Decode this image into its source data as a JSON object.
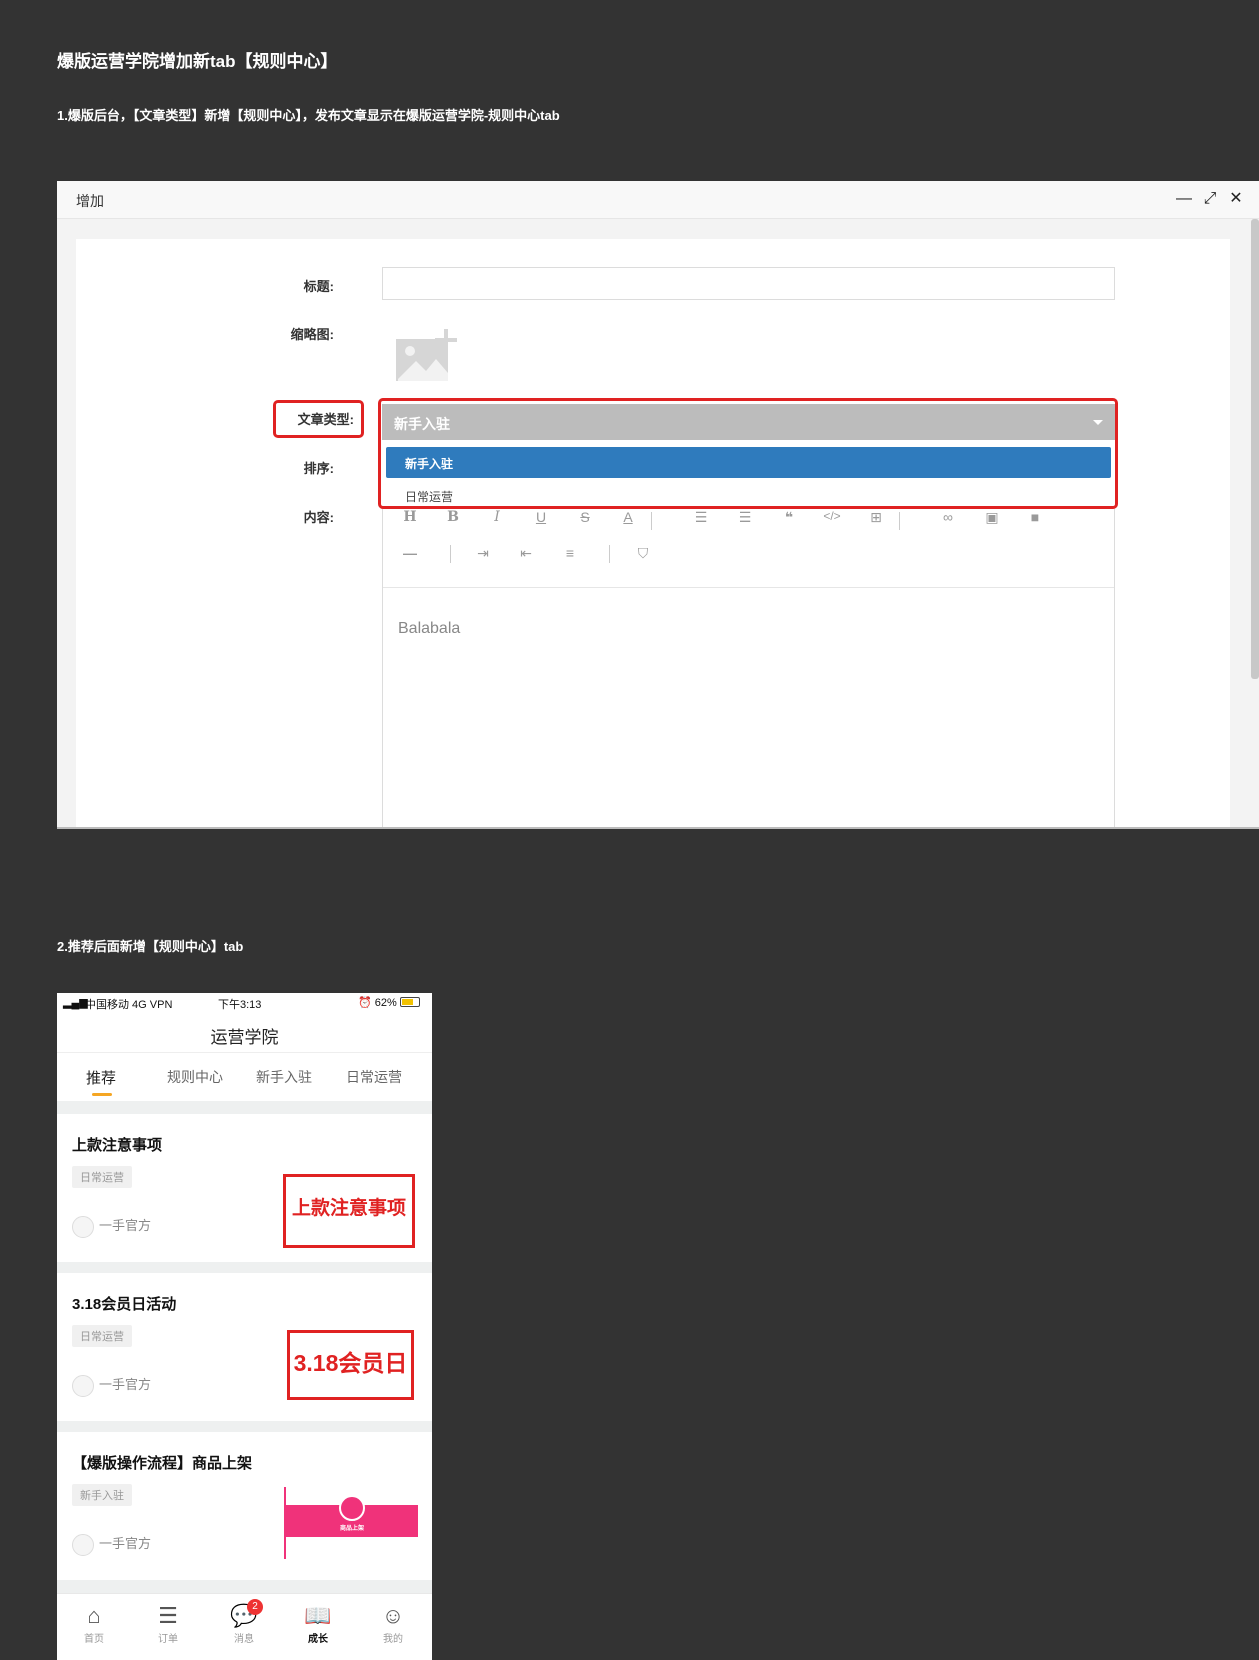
{
  "doc": {
    "title": "爆版运营学院增加新tab【规则中心】",
    "note1": "1.爆版后台，【文章类型】新增【规则中心】，发布文章显示在爆版运营学院-规则中心tab",
    "note2": "2.推荐后面新增【规则中心】tab"
  },
  "dialog": {
    "title": "增加",
    "controls": {
      "minimize": "—",
      "maximize": "⤢",
      "close": "✕"
    },
    "form": {
      "title_label": "标题:",
      "thumb_label": "缩略图:",
      "type_label": "文章类型:",
      "sort_label": "排序:",
      "content_label": "内容:",
      "type_selected": "新手入驻",
      "type_options": [
        "新手入驻",
        "日常运营"
      ],
      "editor_text": "Balabala"
    }
  },
  "phone": {
    "status": {
      "carrier": "中国移动 4G VPN",
      "time": "下午3:13",
      "battery": "⏰ 62%"
    },
    "title": "运营学院",
    "tabs": [
      "推荐",
      "规则中心",
      "新手入驻",
      "日常运营"
    ],
    "active_tab": "推荐",
    "articles": [
      {
        "title": "上款注意事项",
        "tag": "日常运营",
        "author": "一手官方",
        "thumb_text": "上款注意事项"
      },
      {
        "title": "3.18会员日活动",
        "tag": "日常运营",
        "author": "一手官方",
        "thumb_text": "3.18会员日"
      },
      {
        "title": "【爆版操作流程】商品上架",
        "tag": "新手入驻",
        "author": "一手官方",
        "thumb_text": "商品上架"
      }
    ],
    "tabbar": [
      {
        "label": "首页",
        "icon": "home-icon"
      },
      {
        "label": "订单",
        "icon": "order-icon"
      },
      {
        "label": "消息",
        "icon": "message-icon",
        "badge": "2"
      },
      {
        "label": "成长",
        "icon": "book-icon"
      },
      {
        "label": "我的",
        "icon": "profile-icon"
      }
    ],
    "accent": "#f5a623",
    "brand_pink": "#f0327a"
  }
}
